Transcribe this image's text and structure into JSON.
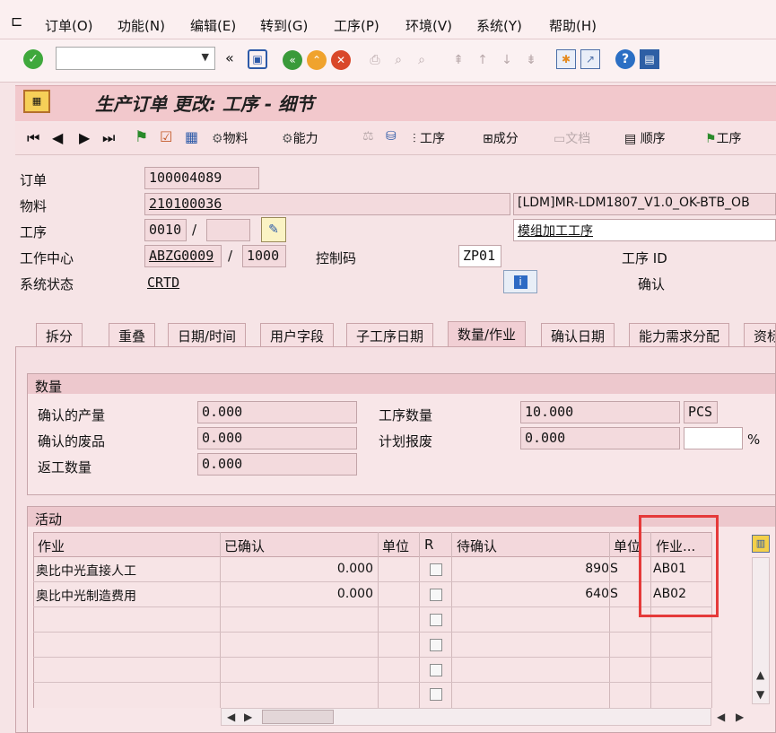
{
  "menu": [
    "订单(O)",
    "功能(N)",
    "编辑(E)",
    "转到(G)",
    "工序(P)",
    "环境(V)",
    "系统(Y)",
    "帮助(H)"
  ],
  "toolbar": {
    "command_value": ""
  },
  "title": "生产订单 更改: 工序 - 细节",
  "app_toolbar": {
    "material": "物料",
    "capacity": "能力",
    "operation": "工序",
    "component": "成分",
    "document": "文档",
    "sequence": "顺序",
    "operation2": "工序"
  },
  "header": {
    "order_label": "订单",
    "order": "100004089",
    "material_label": "物料",
    "material": "210100036",
    "material_desc": "[LDM]MR-LDM1807_V1.0_OK-BTB_OB",
    "op_label": "工序",
    "op": "0010",
    "op_slash": "/",
    "op_desc": "模组加工工序",
    "wc_label": "工作中心",
    "wc": "ABZG0009",
    "wc_slash": "/",
    "plant": "1000",
    "ctrl_label": "控制码",
    "ctrl": "ZP01",
    "opid_label": "工序 ID",
    "status_label": "系统状态",
    "status": "CRTD",
    "confirm_label": "确认"
  },
  "tabs": [
    "拆分",
    "重叠",
    "日期/时间",
    "用户字段",
    "子工序日期",
    "数量/作业",
    "确认日期",
    "能力需求分配",
    "资标"
  ],
  "quantity": {
    "title": "数量",
    "confirmed_yield_label": "确认的产量",
    "confirmed_yield": "0.000",
    "confirmed_scrap_label": "确认的废品",
    "confirmed_scrap": "0.000",
    "rework_label": "返工数量",
    "rework": "0.000",
    "op_qty_label": "工序数量",
    "op_qty": "10.000",
    "op_unit": "PCS",
    "planned_scrap_label": "计划报废",
    "planned_scrap": "0.000",
    "percent": "%"
  },
  "activity": {
    "title": "活动",
    "headers": [
      "作业",
      "已确认",
      "单位",
      "R",
      "待确认",
      "单位",
      "作业..."
    ],
    "rows": [
      {
        "name": "奥比中光直接人工",
        "confirmed": "0.000",
        "pending": "890",
        "unit": "S",
        "act": "AB01"
      },
      {
        "name": "奥比中光制造费用",
        "confirmed": "0.000",
        "pending": "640",
        "unit": "S",
        "act": "AB02"
      }
    ]
  }
}
